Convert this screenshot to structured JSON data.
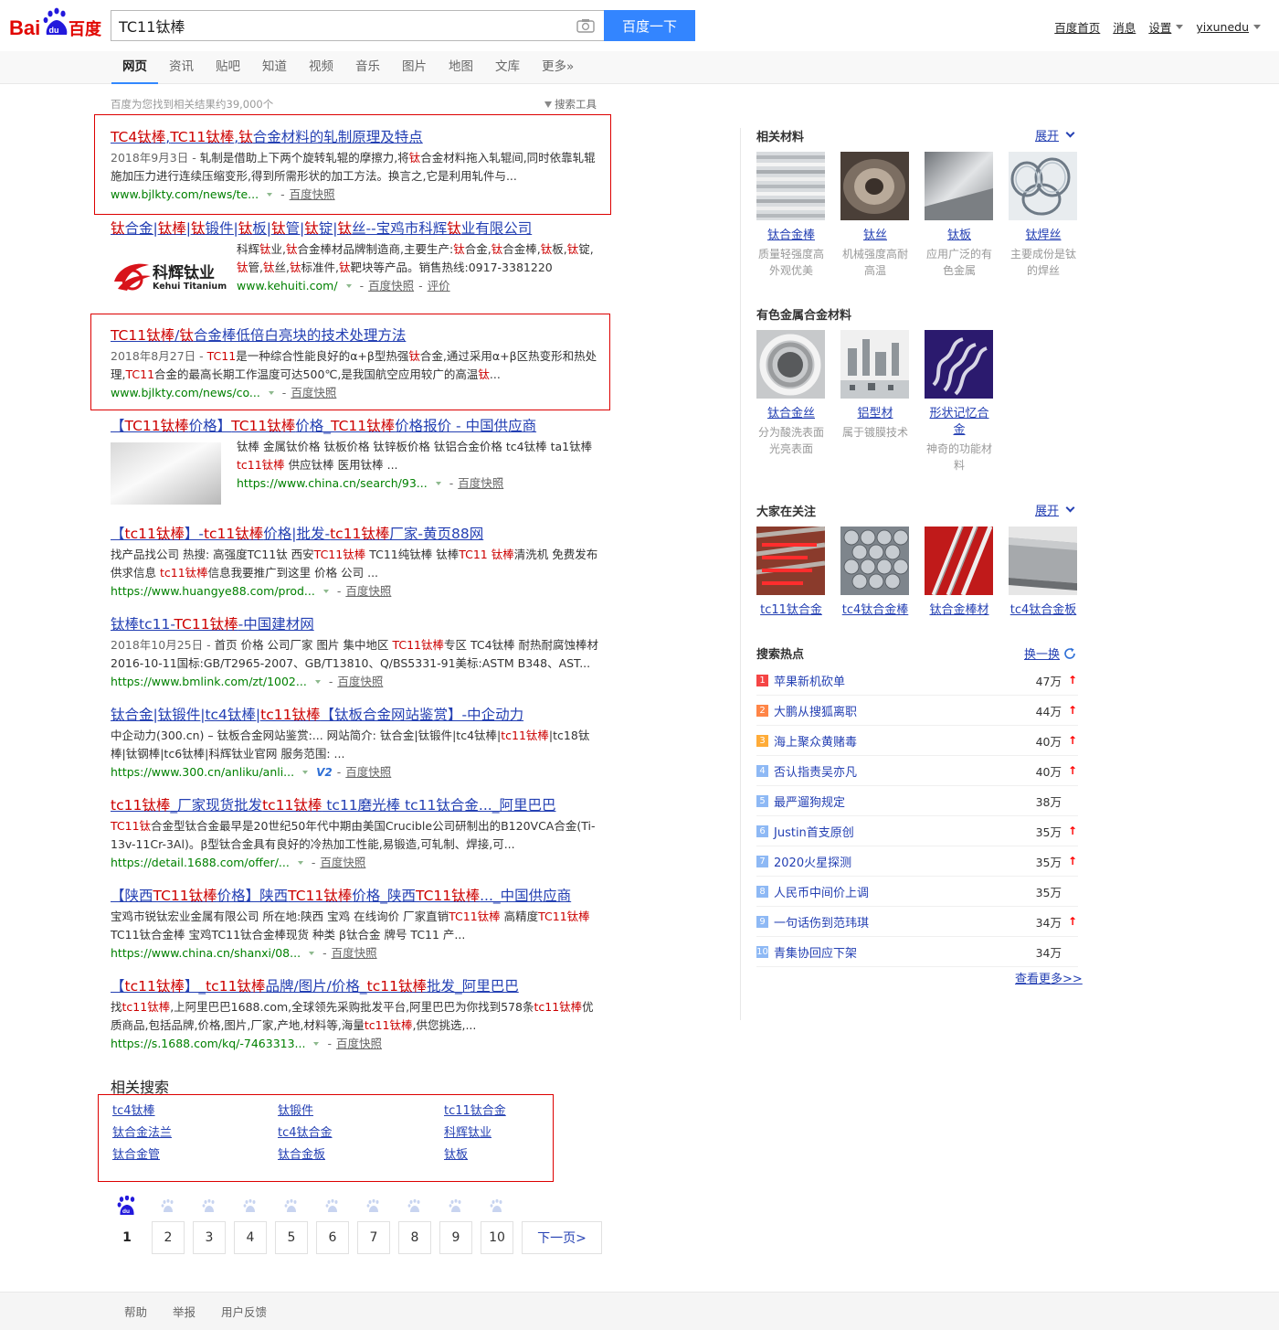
{
  "header": {
    "logo_bai": "Bai",
    "logo_du": "du",
    "logo_cn": "百度",
    "query": "TC11钛棒",
    "search_button": "百度一下",
    "nav": [
      "百度首页",
      "消息",
      "设置",
      "yixunedu"
    ]
  },
  "tabs": [
    "网页",
    "资讯",
    "贴吧",
    "知道",
    "视频",
    "音乐",
    "图片",
    "地图",
    "文库",
    "更多»"
  ],
  "result_count": "百度为您找到相关结果约39,000个",
  "search_tools": "搜索工具",
  "results": [
    {
      "title": [
        "",
        "TC4钛棒",
        ",",
        "TC11钛棒",
        ",",
        "钛",
        "合金材料的轧制原理及特点"
      ],
      "date": "2018年9月3日 - ",
      "abstract": [
        "轧制是借助上下两个旋转轧辊的摩擦力,将",
        "钛",
        "合金材料拖入轧辊间,同时依靠轧辊施加压力进行连续压缩变形,得到所需形状的加工方法。换言之,它是利用轧件与..."
      ],
      "url": "www.bjlkty.com/news/te...",
      "snapshot": "百度快照"
    },
    {
      "title": [
        "",
        "钛",
        "合金|",
        "钛棒",
        "|",
        "钛",
        "锻件|",
        "钛",
        "板|",
        "钛",
        "管|",
        "钛",
        "锭|",
        "钛",
        "丝--宝鸡市科辉",
        "钛",
        "业有限公司"
      ],
      "abstract": [
        "科辉",
        "钛",
        "业,",
        "钛",
        "合金棒材品牌制造商,主要生产:",
        "钛",
        "合金,",
        "钛",
        "合金棒,",
        "钛",
        "板,",
        "钛",
        "锭,",
        "钛",
        "管,",
        "钛",
        "丝,",
        "钛",
        "标准件,",
        "钛",
        "靶块等产品。销售热线:0917-3381220"
      ],
      "url": "www.kehuiti.com/",
      "snapshot": "百度快照",
      "review": "评价",
      "logo_cn": "科辉钛业",
      "logo_en": "Kehui Titanium"
    },
    {
      "title": [
        "",
        "TC11钛棒",
        "/",
        "钛",
        "合金棒低倍白亮块的技术处理方法"
      ],
      "date": "2018年8月27日 - ",
      "abstract": [
        "",
        "TC11",
        "是一种综合性能良好的α+β型热强",
        "钛",
        "合金,通过采用α+β区热变形和热处理,",
        "TC11",
        "合金的最高长期工作温度可达500℃,是我国航空应用较广的高温",
        "钛",
        "..."
      ],
      "url": "www.bjlkty.com/news/co...",
      "snapshot": "百度快照"
    },
    {
      "title": [
        "【",
        "TC11钛棒",
        "价格】",
        "TC11钛棒",
        "价格_",
        "TC11钛棒",
        "价格报价 - 中国供应商"
      ],
      "abstract": [
        "钛棒 金属钛价格 钛板价格 钛锌板价格 钛铝合金价格 tc4钛棒 ta1钛棒 ",
        "tc11钛棒",
        " 供应钛棒 医用钛棒 ..."
      ],
      "url": "https://www.china.cn/search/93...",
      "snapshot": "百度快照"
    },
    {
      "title": [
        "【",
        "tc11钛棒",
        "】-",
        "tc11钛棒",
        "价格|批发-",
        "tc11钛棒",
        "厂家-黄页88网"
      ],
      "abstract": [
        "找产品找公司 热搜: 高强度TC11钛 西安",
        "TC11钛棒",
        " TC11纯钛棒 钛棒",
        "TC11 钛棒",
        "清洗机 免费发布供求信息 ",
        "tc11钛棒",
        "信息我要推广到这里 价格 公司 ..."
      ],
      "url": "https://www.huangye88.com/prod...",
      "snapshot": "百度快照"
    },
    {
      "title": [
        "钛棒tc11-",
        "TC11钛棒",
        "-中国建材网"
      ],
      "date": "2018年10月25日 - ",
      "abstract": [
        "首页 价格 公司厂家 图片 集中地区 ",
        "TC11钛棒",
        "专区 TC4钛棒 耐热耐腐蚀棒材 2016-10-11国标:GB/T2965-2007、GB/T13810、Q/BS5331-91美标:ASTM B348、AST..."
      ],
      "url": "https://www.bmlink.com/zt/1002...",
      "snapshot": "百度快照"
    },
    {
      "title": [
        "钛合金|钛锻件|tc4钛棒|",
        "tc11钛棒",
        "【钛板合金网站鉴赏】-中企动力"
      ],
      "abstract": [
        "中企动力(300.cn) – 钛板合金网站鉴赏:... 网站简介: 钛合金|钛锻件|tc4钛棒|",
        "tc11钛棒",
        "|tc18钛棒|钛钢棒|tc6钛棒|科辉钛业官网 服务范围: ..."
      ],
      "url": "https://www.300.cn/anliku/anli...",
      "badge": "V2",
      "snapshot": "百度快照"
    },
    {
      "title": [
        "",
        "tc11钛棒",
        "_厂家现货批发",
        "tc11钛棒",
        " tc11磨光棒 tc11钛合金..._阿里巴巴"
      ],
      "abstract": [
        "",
        "TC11钛",
        "合金型钛合金最早是20世纪50年代中期由美国Crucible公司研制出的B120VCA合金(Ti-13v-11Cr-3Al)。β型钛合金具有良好的冷热加工性能,易锻造,可轧制、焊接,可..."
      ],
      "url": "https://detail.1688.com/offer/...",
      "snapshot": "百度快照"
    },
    {
      "title": [
        "【陕西",
        "TC11钛棒",
        "价格】陕西",
        "TC11钛棒",
        "价格_陕西",
        "TC11钛棒",
        "..._中国供应商"
      ],
      "abstract": [
        "宝鸡市锐钛宏业金属有限公司 所在地:陕西 宝鸡 在线询价 厂家直销",
        "TC11钛棒",
        " 高精度",
        "TC11钛棒",
        " TC11钛合金棒 宝鸡TC11钛合金棒现货 种类 β钛合金 牌号 TC11 产..."
      ],
      "url": "https://www.china.cn/shanxi/08...",
      "snapshot": "百度快照"
    },
    {
      "title": [
        "【",
        "tc11钛棒",
        "】_",
        "tc11钛棒",
        "品牌/图片/价格_",
        "tc11钛棒",
        "批发_阿里巴巴"
      ],
      "abstract": [
        "找",
        "tc11钛棒",
        ",上阿里巴巴1688.com,全球领先采购批发平台,阿里巴巴为你找到578条",
        "tc11钛棒",
        "优质商品,包括品牌,价格,图片,厂家,产地,材料等,海量",
        "tc11钛棒",
        ",供您挑选,..."
      ],
      "url": "https://s.1688.com/kq/-7463313...",
      "snapshot": "百度快照"
    }
  ],
  "related_title": "相关搜索",
  "related": [
    "tc4钛棒",
    "钛锻件",
    "tc11钛合金",
    "钛合金法兰",
    "tc4钛合金",
    "科辉钛业",
    "钛合金管",
    "钛合金板",
    "钛板"
  ],
  "pages": [
    "1",
    "2",
    "3",
    "4",
    "5",
    "6",
    "7",
    "8",
    "9",
    "10"
  ],
  "next_page": "下一页>",
  "footer": [
    "帮助",
    "举报",
    "用户反馈"
  ],
  "right": {
    "expand": "展开",
    "materials_title": "相关材料",
    "materials": [
      {
        "name": "钛合金棒",
        "desc": "质量轻强度高外观优美"
      },
      {
        "name": "钛丝",
        "desc": "机械强度高耐高温"
      },
      {
        "name": "钛板",
        "desc": "应用广泛的有色金属"
      },
      {
        "name": "钛焊丝",
        "desc": "主要成份是钛的焊丝"
      }
    ],
    "nonferrous_title": "有色金属合金材料",
    "nonferrous": [
      {
        "name": "钛合金丝",
        "desc": "分为酸洗表面光亮表面"
      },
      {
        "name": "铝型材",
        "desc": "属于镀膜技术"
      },
      {
        "name": "形状记忆合金",
        "desc": "神奇的功能材料"
      }
    ],
    "attention_title": "大家在关注",
    "attention": [
      "tc11钛合金",
      "tc4钛合金棒",
      "钛合金棒材",
      "tc4钛合金板"
    ],
    "hot_title": "搜索热点",
    "swap": "换一换",
    "hot": [
      {
        "rank": "1",
        "q": "苹果新机砍单",
        "cnt": "47万",
        "up": "↑"
      },
      {
        "rank": "2",
        "q": "大鹏从搜狐离职",
        "cnt": "44万",
        "up": "↑"
      },
      {
        "rank": "3",
        "q": "海上聚众黄赌毒",
        "cnt": "40万",
        "up": "↑"
      },
      {
        "rank": "4",
        "q": "否认指责吴亦凡",
        "cnt": "40万",
        "up": "↑"
      },
      {
        "rank": "5",
        "q": "最严遛狗规定",
        "cnt": "38万",
        "up": ""
      },
      {
        "rank": "6",
        "q": "Justin首支原创",
        "cnt": "35万",
        "up": "↑"
      },
      {
        "rank": "7",
        "q": "2020火星探测",
        "cnt": "35万",
        "up": "↑"
      },
      {
        "rank": "8",
        "q": "人民币中间价上调",
        "cnt": "35万",
        "up": ""
      },
      {
        "rank": "9",
        "q": "一句话伤到范玮琪",
        "cnt": "34万",
        "up": "↑"
      },
      {
        "rank": "10",
        "q": "青集协回应下架",
        "cnt": "34万",
        "up": ""
      }
    ],
    "hot_more": "查看更多>>"
  }
}
